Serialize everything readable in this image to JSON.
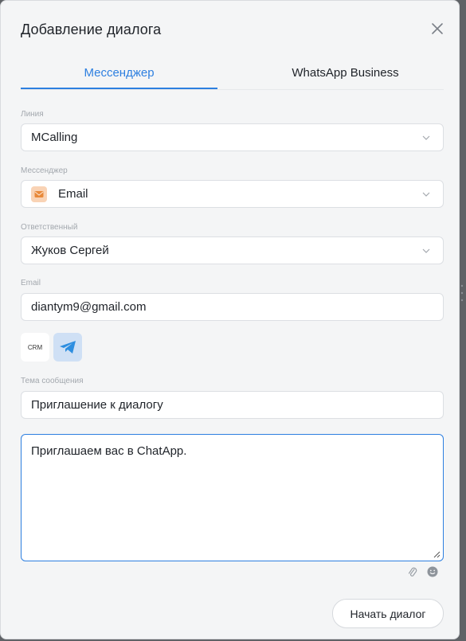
{
  "dialog": {
    "title": "Добавление диалога",
    "close_icon": "close-icon"
  },
  "tabs": [
    {
      "label": "Мессенджер",
      "active": true
    },
    {
      "label": "WhatsApp Business",
      "active": false
    }
  ],
  "form": {
    "line": {
      "label": "Линия",
      "value": "MCalling"
    },
    "messenger": {
      "label": "Мессенджер",
      "value": "Email",
      "icon": "envelope-icon"
    },
    "responsible": {
      "label": "Ответственный",
      "value": "Жуков Сергей"
    },
    "email": {
      "label": "Email",
      "value": "diantym9@gmail.com"
    },
    "channels": {
      "crm_label": "CRM",
      "telegram_icon": "telegram-icon"
    },
    "subject": {
      "label": "Тема сообщения",
      "value": "Приглашение к диалогу"
    },
    "message": {
      "value": "Приглашаем вас в ChatApp."
    }
  },
  "actions": {
    "start_label": "Начать диалог",
    "attach_icon": "paperclip-icon",
    "emoji_icon": "emoji-icon"
  },
  "colors": {
    "accent": "#2d7fe0",
    "email_icon_bg": "#f9d3b5",
    "telegram_bg": "#cfe0f5"
  }
}
